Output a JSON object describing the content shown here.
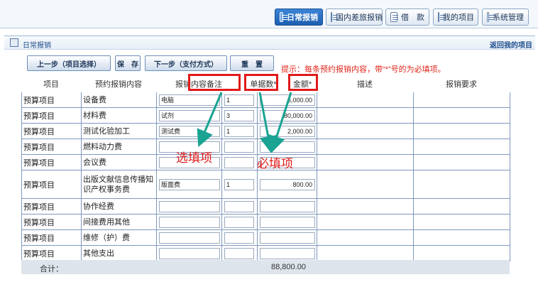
{
  "top_tabs": [
    {
      "label": "日常报销",
      "active": true
    },
    {
      "label": "国内差旅报销",
      "active": false
    },
    {
      "label": "借　款",
      "active": false
    },
    {
      "label": "我的项目",
      "active": false
    },
    {
      "label": "系统管理",
      "active": false
    }
  ],
  "section": {
    "title": "日常报销",
    "return_link": "返回我的项目"
  },
  "buttons": {
    "prev": "上一步（项目选择）",
    "save": "保　存",
    "next": "下一步（支付方式）",
    "reset": "重　置"
  },
  "tip": "提示：每条预约报销内容，带“*”号的为必填项。",
  "headers": {
    "type": "项目",
    "item": "预约报销内容",
    "note": "报销内容备注",
    "num": "单据数*",
    "amount": "金额*",
    "desc": "描述",
    "req": "报销要求"
  },
  "rows": [
    {
      "type": "预算项目",
      "item": "设备费",
      "note": "电脑",
      "num": "1",
      "amount": "6,000.00"
    },
    {
      "type": "预算项目",
      "item": "材料费",
      "note": "试剂",
      "num": "3",
      "amount": "80,000.00"
    },
    {
      "type": "预算项目",
      "item": "测试化验加工",
      "note": "测试费",
      "num": "1",
      "amount": "2,000.00"
    },
    {
      "type": "预算项目",
      "item": "燃料动力费",
      "note": "",
      "num": "",
      "amount": ""
    },
    {
      "type": "预算项目",
      "item": "会议费",
      "note": "",
      "num": "",
      "amount": ""
    },
    {
      "type": "预算项目",
      "item": "出版文献信息传播知识产权事务费",
      "note": "版面费",
      "num": "1",
      "amount": "800.00"
    },
    {
      "type": "预算项目",
      "item": "协作经费",
      "note": "",
      "num": "",
      "amount": ""
    },
    {
      "type": "预算项目",
      "item": "间接费用其他",
      "note": "",
      "num": "",
      "amount": ""
    },
    {
      "type": "预算项目",
      "item": "维修（护）费",
      "note": "",
      "num": "",
      "amount": ""
    },
    {
      "type": "预算项目",
      "item": "其他支出",
      "note": "",
      "num": "",
      "amount": ""
    }
  ],
  "total": {
    "label": "合计：",
    "value": "88,800.00"
  },
  "annotations": {
    "optional": "选填项",
    "required": "必填项"
  },
  "colors": {
    "accent": "#1d5fb0",
    "annotation": "#e11919",
    "grid": "#7e98bf"
  }
}
